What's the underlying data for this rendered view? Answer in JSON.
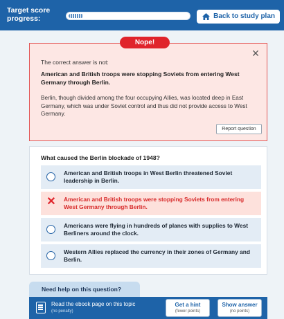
{
  "header": {
    "score_label": "Target score progress:",
    "progress_value": 0.12,
    "back_button": "Back to study plan"
  },
  "feedback": {
    "badge": "Nope!",
    "close": "×",
    "intro": "The correct answer is not:",
    "answer": "American and British troops were stopping Soviets from entering West Germany through Berlin.",
    "explanation": "Berlin, though divided among the four occupying Allies, was located deep in East Germany, which was under Soviet control and thus did not provide access to West Germany.",
    "report_button": "Report question"
  },
  "question": {
    "text": "What caused the Berlin blockade of 1948?",
    "options": [
      {
        "label": "American and British troops in West Berlin threatened Soviet leadership in Berlin.",
        "state": "unselected"
      },
      {
        "label": "American and British troops were stopping Soviets from entering West Germany through Berlin.",
        "state": "wrong"
      },
      {
        "label": "Americans were flying in hundreds of planes with supplies to West Berliners around the clock.",
        "state": "unselected"
      },
      {
        "label": "Western Allies replaced the currency in their zones of Germany and Berlin.",
        "state": "unselected"
      }
    ],
    "wrong_mark": "✕"
  },
  "help": {
    "tab_label": "Need help on this question?",
    "ebook_label": "Read the ebook page on this topic",
    "ebook_sub": "(no penalty)",
    "hint_label": "Get a hint",
    "hint_sub": "(fewer points)",
    "show_label": "Show answer",
    "show_sub": "(no points)"
  },
  "colors": {
    "brand_blue": "#1e63a8",
    "error_red": "#e0242b",
    "wrong_bg": "#fde1dc",
    "option_bg": "#e3ecf5"
  }
}
